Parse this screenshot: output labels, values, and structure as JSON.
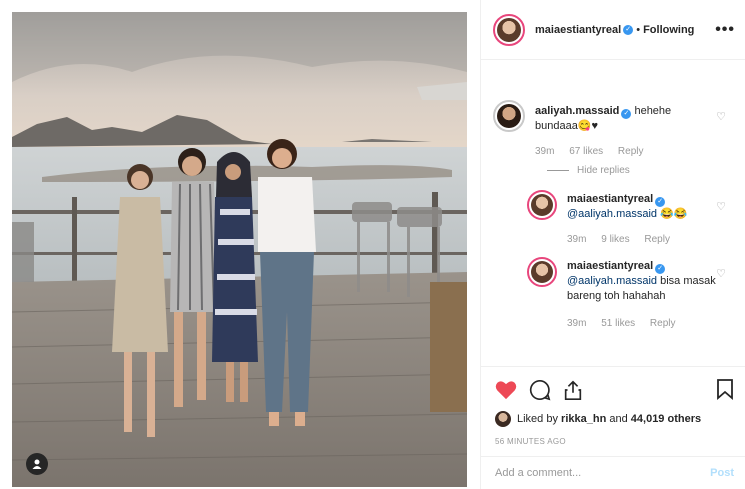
{
  "post": {
    "author": "maiaestiantyreal",
    "follow_status": "Following",
    "more_label": "•••"
  },
  "comments": [
    {
      "username": "aaliyah.massaid",
      "text": "hehehe bundaaa😋♥",
      "time": "39m",
      "likes": "67 likes",
      "reply": "Reply",
      "hide_replies": "Hide replies"
    }
  ],
  "replies": [
    {
      "username": "maiaestiantyreal",
      "mention": "@aaliyah.massaid",
      "text": "😂😂",
      "time": "39m",
      "likes": "9 likes",
      "reply": "Reply"
    },
    {
      "username": "maiaestiantyreal",
      "mention": "@aaliyah.massaid",
      "text": "bisa masak bareng toh hahahah",
      "time": "39m",
      "likes": "51 likes",
      "reply": "Reply"
    }
  ],
  "likes_line": {
    "prefix": "Liked by",
    "user": "rikka_hn",
    "middle": "and",
    "count": "44,019 others"
  },
  "timestamp": "56 MINUTES AGO",
  "comment_box": {
    "placeholder": "Add a comment...",
    "post_label": "Post"
  },
  "colors": {
    "heart": "#ed4956",
    "verified": "#3897f0",
    "story_ring": "#e8467c",
    "post_disabled": "#b2dffc"
  },
  "icons": [
    "heart-icon",
    "comment-icon",
    "share-icon",
    "bookmark-icon",
    "user-tag-icon",
    "verified-icon",
    "small-heart-icon",
    "more-options-icon"
  ]
}
